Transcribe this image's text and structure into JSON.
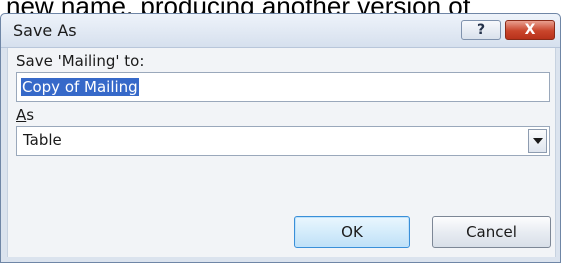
{
  "background_caption": "new name, producing another version of",
  "dialog": {
    "title": "Save As",
    "help_button": "?",
    "close_button": "X",
    "save_label": "Save 'Mailing' to:",
    "name_value": "Copy of Mailing",
    "as_label_accel": "A",
    "as_label_rest": "s",
    "as_value": "Table",
    "ok_label": "OK",
    "cancel_label": "Cancel"
  },
  "colors": {
    "accent": "#3669c9",
    "close": "#c9452b",
    "frame": "#dbe3ee"
  }
}
